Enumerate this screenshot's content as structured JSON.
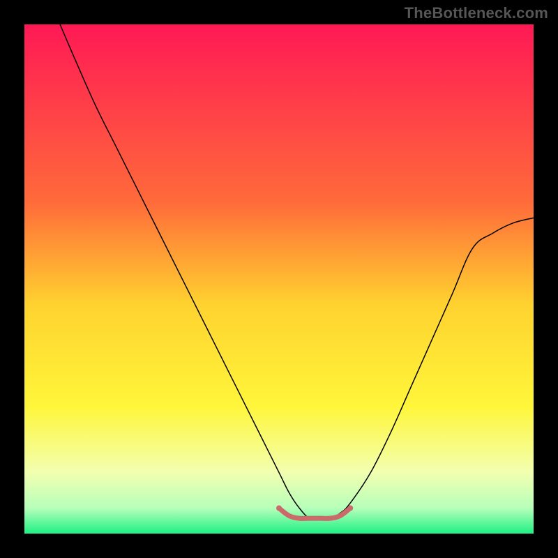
{
  "watermark": "TheBottleneck.com",
  "chart_data": {
    "type": "line",
    "title": "",
    "xlabel": "",
    "ylabel": "",
    "xlim": [
      0,
      100
    ],
    "ylim": [
      0,
      100
    ],
    "background_gradient": {
      "stops": [
        {
          "offset": 0,
          "color": "#ff1955"
        },
        {
          "offset": 35,
          "color": "#ff6b3a"
        },
        {
          "offset": 55,
          "color": "#ffd22f"
        },
        {
          "offset": 75,
          "color": "#fff63a"
        },
        {
          "offset": 88,
          "color": "#f2ffb0"
        },
        {
          "offset": 95,
          "color": "#b6ffba"
        },
        {
          "offset": 100,
          "color": "#1ef083"
        }
      ]
    },
    "series": [
      {
        "name": "bottleneck-curve",
        "color": "#000000",
        "stroke_width": 1.5,
        "x": [
          7,
          10,
          14,
          18,
          22,
          26,
          30,
          34,
          38,
          42,
          46,
          50,
          52,
          54,
          56,
          58,
          60,
          62,
          64,
          68,
          72,
          76,
          80,
          84,
          88,
          92,
          96,
          100
        ],
        "y": [
          100,
          93,
          84,
          76,
          68,
          60,
          52,
          44,
          36,
          28,
          20,
          12,
          8,
          5,
          3,
          3,
          3,
          4,
          6,
          12,
          20,
          29,
          38,
          47,
          56,
          59,
          61,
          62
        ]
      }
    ],
    "marker_band": {
      "name": "optimal-range",
      "color": "#cb6a6a",
      "stroke_width": 7,
      "x": [
        50,
        52,
        54,
        56,
        58,
        60,
        62,
        64
      ],
      "y": [
        5,
        3.5,
        3,
        3,
        3,
        3,
        3.5,
        5
      ],
      "endpoints": [
        {
          "x": 50,
          "y": 5,
          "r": 4
        },
        {
          "x": 64,
          "y": 5,
          "r": 4
        }
      ]
    }
  }
}
